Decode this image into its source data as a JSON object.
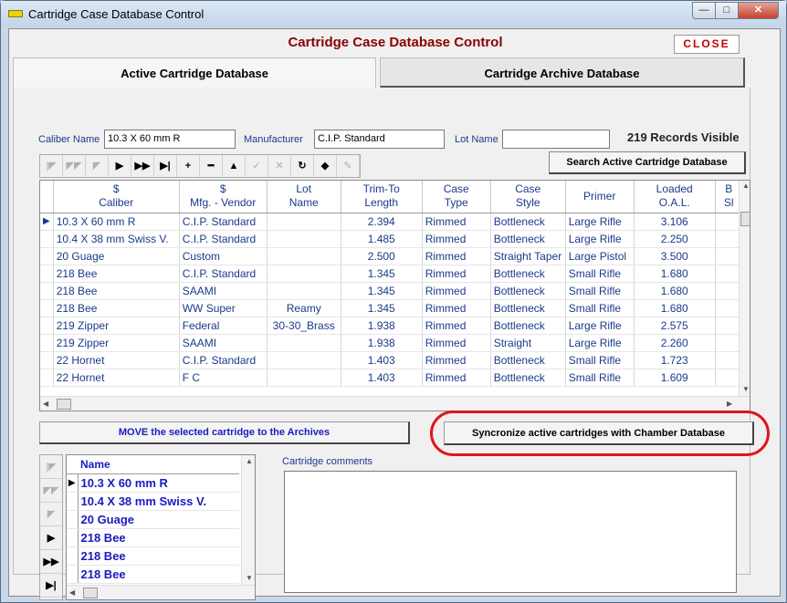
{
  "window": {
    "title": "Cartridge Case Database Control",
    "min": "—",
    "max": "□",
    "close": "✕"
  },
  "header": {
    "title": "Cartridge Case Database Control",
    "close_label": "CLOSE"
  },
  "tabs": [
    {
      "label": "Active Cartridge Database"
    },
    {
      "label": "Cartridge Archive Database"
    }
  ],
  "filters": {
    "caliber_label": "Caliber Name",
    "caliber_value": "10.3 X 60 mm R",
    "manufacturer_label": "Manufacturer",
    "manufacturer_value": "C.I.P. Standard",
    "lot_label": "Lot Name",
    "lot_value": "",
    "records_visible": "219 Records Visible"
  },
  "navigator": {
    "buttons": [
      {
        "name": "nav-first-icon",
        "glyph": "|◤",
        "enabled": false
      },
      {
        "name": "nav-prior-page-icon",
        "glyph": "◤◤",
        "enabled": false
      },
      {
        "name": "nav-prior-icon",
        "glyph": "◤",
        "enabled": false
      },
      {
        "name": "nav-next-icon",
        "glyph": "▶",
        "enabled": true
      },
      {
        "name": "nav-next-page-icon",
        "glyph": "▶▶",
        "enabled": true
      },
      {
        "name": "nav-last-icon",
        "glyph": "▶|",
        "enabled": true
      },
      {
        "name": "nav-insert-icon",
        "glyph": "+",
        "enabled": true
      },
      {
        "name": "nav-delete-icon",
        "glyph": "━",
        "enabled": true
      },
      {
        "name": "nav-edit-icon",
        "glyph": "▲",
        "enabled": true
      },
      {
        "name": "nav-post-icon",
        "glyph": "✓",
        "enabled": false
      },
      {
        "name": "nav-cancel-icon",
        "glyph": "✕",
        "enabled": false
      },
      {
        "name": "nav-refresh-icon",
        "glyph": "↻",
        "enabled": true
      },
      {
        "name": "nav-apply-update-icon",
        "glyph": "◆",
        "enabled": true
      },
      {
        "name": "nav-cancel-update-icon",
        "glyph": "✎",
        "enabled": false
      }
    ],
    "search_label": "Search  Active Cartridge Database"
  },
  "grid": {
    "columns": [
      {
        "line1": "$",
        "line2": "Caliber"
      },
      {
        "line1": "$",
        "line2": "Mfg. - Vendor"
      },
      {
        "line1": "Lot",
        "line2": "Name"
      },
      {
        "line1": "Trim-To",
        "line2": "Length"
      },
      {
        "line1": "Case",
        "line2": "Type"
      },
      {
        "line1": "Case",
        "line2": "Style"
      },
      {
        "line1": "",
        "line2": "Primer"
      },
      {
        "line1": "Loaded",
        "line2": "O.A.L."
      },
      {
        "line1": "B",
        "line2": "Sl"
      }
    ],
    "rows": [
      [
        "10.3 X 60 mm R",
        "C.I.P. Standard",
        "",
        "2.394",
        "Rimmed",
        "Bottleneck",
        "Large Rifle",
        "3.106"
      ],
      [
        "10.4 X 38 mm Swiss V.",
        "C.I.P. Standard",
        "",
        "1.485",
        "Rimmed",
        "Bottleneck",
        "Large Rifle",
        "2.250"
      ],
      [
        "20 Guage",
        "Custom",
        "",
        "2.500",
        "Rimmed",
        "Straight Taper",
        "Large Pistol",
        "3.500"
      ],
      [
        "218 Bee",
        "C.I.P. Standard",
        "",
        "1.345",
        "Rimmed",
        "Bottleneck",
        "Small Rifle",
        "1.680"
      ],
      [
        "218 Bee",
        "SAAMI",
        "",
        "1.345",
        "Rimmed",
        "Bottleneck",
        "Small Rifle",
        "1.680"
      ],
      [
        "218 Bee",
        "WW Super",
        "Reamy",
        "1.345",
        "Rimmed",
        "Bottleneck",
        "Small Rifle",
        "1.680"
      ],
      [
        "219 Zipper",
        "Federal",
        "30-30_Brass",
        "1.938",
        "Rimmed",
        "Bottleneck",
        "Large Rifle",
        "2.575"
      ],
      [
        "219 Zipper",
        "SAAMI",
        "",
        "1.938",
        "Rimmed",
        "Straight",
        "Large Rifle",
        "2.260"
      ],
      [
        "22 Hornet",
        "C.I.P. Standard",
        "",
        "1.403",
        "Rimmed",
        "Bottleneck",
        "Small Rifle",
        "1.723"
      ],
      [
        "22 Hornet",
        "F C",
        "",
        "1.403",
        "Rimmed",
        "Bottleneck",
        "Small Rifle",
        "1.609"
      ]
    ],
    "current_row_marker": "▶"
  },
  "actions": {
    "move_label": "MOVE the selected cartridge  to the Archives",
    "sync_label": "Syncronize active cartridges with Chamber Database"
  },
  "lower_nav": {
    "buttons": [
      {
        "name": "lower-nav-first-icon",
        "glyph": "|◤",
        "enabled": false
      },
      {
        "name": "lower-nav-prior-page-icon",
        "glyph": "◤◤",
        "enabled": false
      },
      {
        "name": "lower-nav-prior-icon",
        "glyph": "◤",
        "enabled": false
      },
      {
        "name": "lower-nav-next-icon",
        "glyph": "▶",
        "enabled": true
      },
      {
        "name": "lower-nav-next-page-icon",
        "glyph": "▶▶",
        "enabled": true
      },
      {
        "name": "lower-nav-last-icon",
        "glyph": "▶|",
        "enabled": true
      }
    ]
  },
  "name_list": {
    "header": "Name",
    "items": [
      "10.3 X 60 mm R",
      "10.4 X 38 mm Swiss V.",
      "20 Guage",
      "218 Bee",
      "218 Bee",
      "218 Bee"
    ]
  },
  "comments": {
    "label": "Cartridge comments",
    "value": ""
  },
  "colors": {
    "accent": "#8b0000",
    "link_blue": "#1a1ac0",
    "highlight": "#e0151b"
  }
}
